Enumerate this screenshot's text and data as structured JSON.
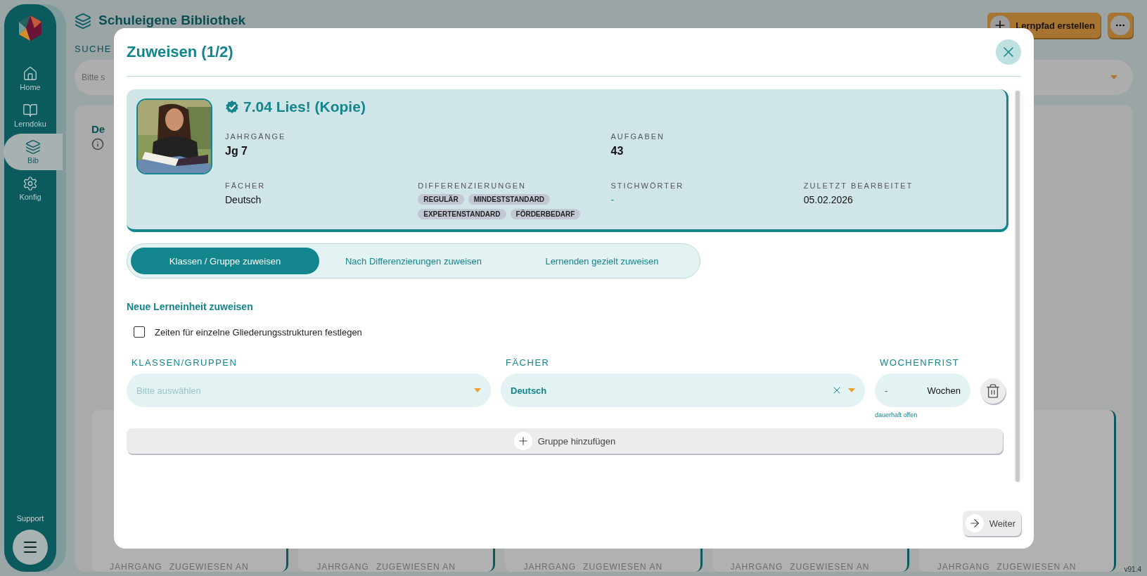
{
  "sidebar": {
    "items": [
      {
        "label": "Home",
        "selected": false
      },
      {
        "label": "Lerndoku",
        "selected": false
      },
      {
        "label": "Bib",
        "selected": true
      },
      {
        "label": "Konfig",
        "selected": false
      }
    ],
    "support": "Support"
  },
  "header": {
    "title": "Schuleigene Bibliothek",
    "create_button": "Lernpfad erstellen"
  },
  "search": {
    "label": "SUCHE",
    "placeholder": "Bitte s"
  },
  "library": {
    "heading": "De",
    "cards": [
      {
        "label_1": "JAHRGANG",
        "label_2": "ZUGEWIESEN AN"
      },
      {
        "label_1": "JAHRGANG",
        "label_2": "ZUGEWIESEN AN"
      },
      {
        "label_1": "JAHRGANG",
        "label_2": "ZUGEWIESEN AN"
      },
      {
        "label_1": "JAHRGANG",
        "label_2": "ZUGEWIESEN AN"
      },
      {
        "label_1": "JAHRGANG",
        "label_2": "ZUGEWIESEN AN"
      }
    ]
  },
  "version": "v91.4",
  "dialog": {
    "title": "Zuweisen (1/2)",
    "item": {
      "title": "7.04 Lies! (Kopie)",
      "verified": true,
      "summary": [
        {
          "label": "JAHRGÄNGE",
          "value": "Jg 7"
        },
        {
          "label": "AUFGABEN",
          "value": "43"
        }
      ],
      "details": [
        {
          "kind": "text",
          "label": "FÄCHER",
          "value": "Deutsch"
        },
        {
          "kind": "tags",
          "label": "DIFFERENZIERUNGEN",
          "tags": [
            "REGULÄR",
            "MINDESTSTANDARD",
            "EXPERTENSTANDARD",
            "FÖRDERBEDARF"
          ]
        },
        {
          "kind": "empty",
          "label": "STICHWÖRTER",
          "value": "-"
        },
        {
          "kind": "text",
          "label": "ZULETZT BEARBEITET",
          "value": "05.02.2026"
        }
      ]
    },
    "tabs": [
      {
        "label": "Klassen / Gruppe zuweisen",
        "selected": true
      },
      {
        "label": "Nach Differenzierungen zuweisen",
        "selected": false
      },
      {
        "label": "Lernenden gezielt zuweisen",
        "selected": false
      }
    ],
    "section_title": "Neue Lerneinheit zuweisen",
    "checkbox": {
      "label": "Zeiten für einzelne Gliederungsstrukturen festlegen",
      "checked": false
    },
    "classes": {
      "label": "KLASSEN/GRUPPEN",
      "placeholder": "Bitte auswählen"
    },
    "subjects": {
      "label": "FÄCHER",
      "value": "Deutsch"
    },
    "deadline": {
      "label": "WOCHENFRIST",
      "value": "-",
      "unit": "Wochen",
      "hint": "dauerhaft offen"
    },
    "add_button": "Gruppe hinzufügen",
    "next_button": "Weiter"
  }
}
